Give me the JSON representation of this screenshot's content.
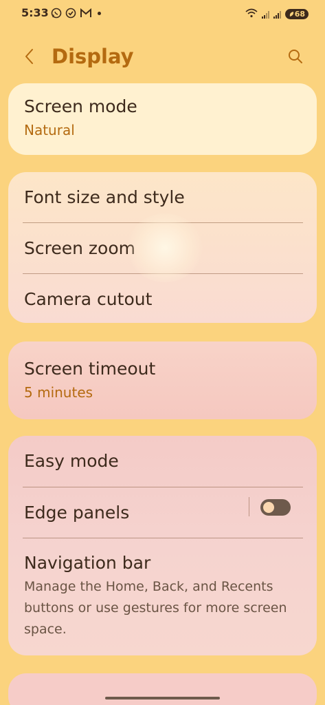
{
  "status_bar": {
    "time": "5:33",
    "notifications": [
      "whatsapp-icon",
      "check-circle-icon",
      "gmail-icon"
    ],
    "battery": "68"
  },
  "header": {
    "title": "Display"
  },
  "sections": {
    "screen_mode": {
      "title": "Screen mode",
      "value": "Natural"
    },
    "font_size": {
      "title": "Font size and style"
    },
    "screen_zoom": {
      "title": "Screen zoom"
    },
    "camera_cutout": {
      "title": "Camera cutout"
    },
    "screen_timeout": {
      "title": "Screen timeout",
      "value": "5 minutes"
    },
    "easy_mode": {
      "title": "Easy mode"
    },
    "edge_panels": {
      "title": "Edge panels",
      "enabled": false
    },
    "navigation_bar": {
      "title": "Navigation bar",
      "description": "Manage the Home, Back, and Recents buttons or use gestures for more screen space."
    }
  },
  "colors": {
    "background": "#fbd37e",
    "accent": "#b46a10",
    "text": "#3d2a1c"
  }
}
